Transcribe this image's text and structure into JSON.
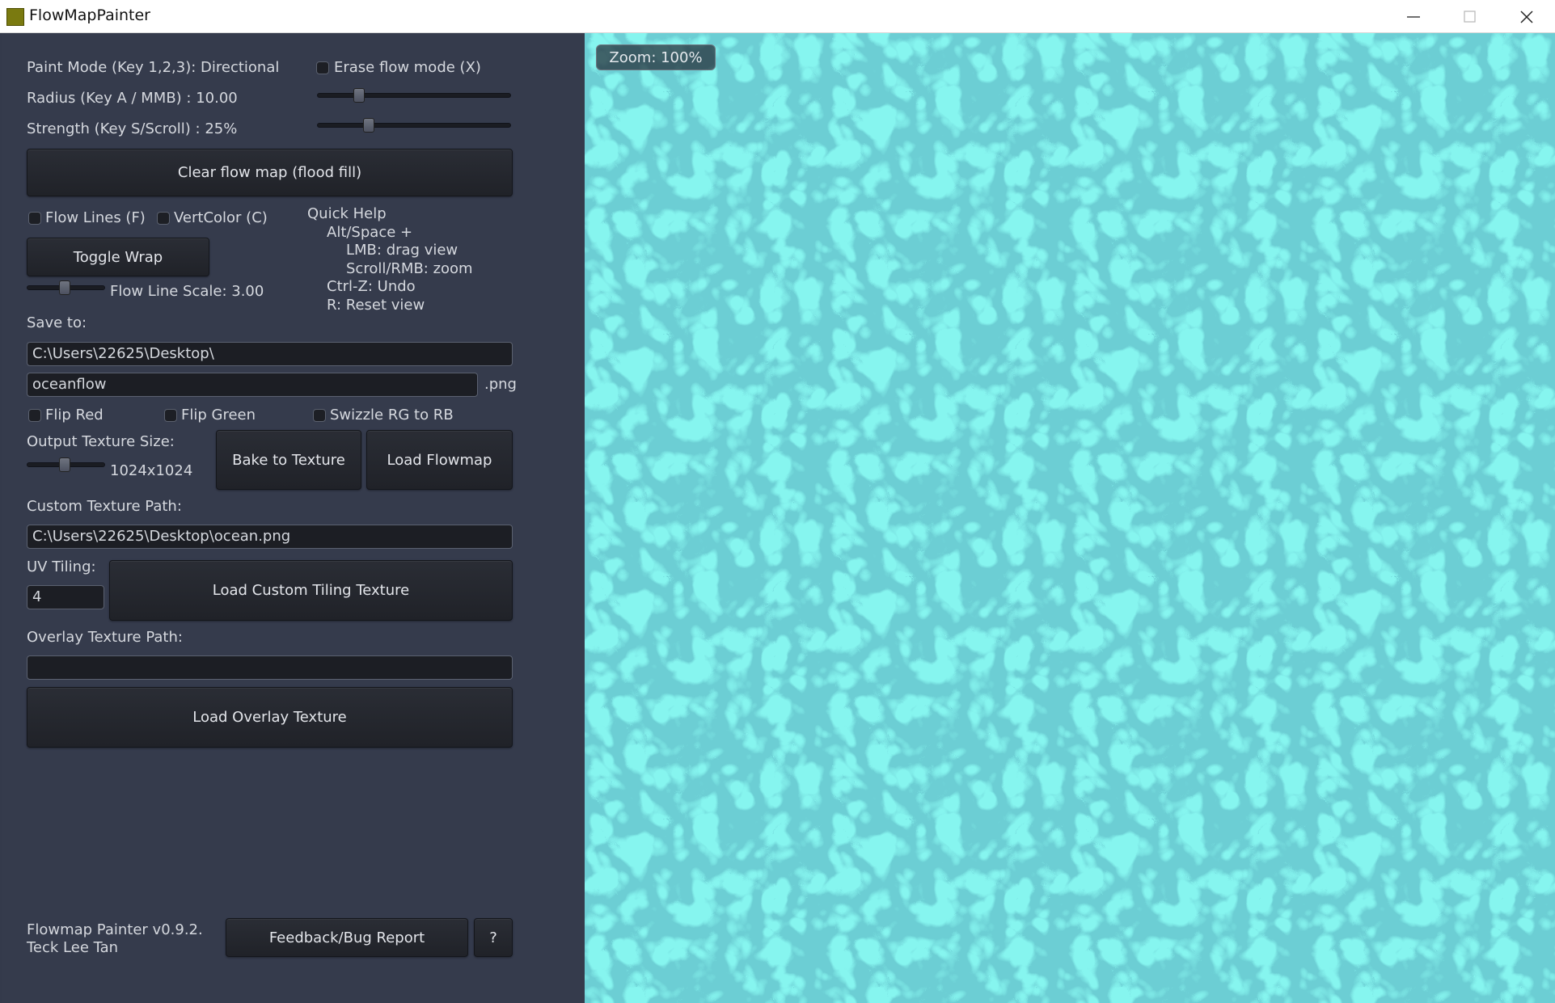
{
  "window": {
    "title": "FlowMapPainter"
  },
  "colors": {
    "panel": "#353b4c",
    "water_light": "#7ff2ea",
    "water_dark": "#0f6f7a"
  },
  "panel": {
    "paint_mode": "Paint Mode (Key 1,2,3): Directional",
    "erase_label": "Erase flow mode (X)",
    "radius": "Radius (Key A / MMB) : 10.00",
    "radius_level": 0.2,
    "strength": "Strength (Key S/Scroll) : 25%",
    "strength_level": 0.25,
    "clear_button": "Clear flow map (flood fill)",
    "flow_lines": "Flow Lines (F)",
    "vert_color": "VertColor (C)",
    "toggle_wrap": "Toggle Wrap",
    "flow_line_scale": "Flow Line Scale: 3.00",
    "help": {
      "title": "Quick Help",
      "line1": "Alt/Space +",
      "line2": "LMB: drag view",
      "line3": "Scroll/RMB: zoom",
      "line4": "Ctrl-Z: Undo",
      "line5": "R: Reset view"
    },
    "save_to": "Save to:",
    "save_path": "C:\\Users\\22625\\Desktop\\",
    "file_name": "oceanflow",
    "ext": ".png",
    "flip_red": "Flip Red",
    "flip_green": "Flip Green",
    "swizzle": "Swizzle RG to RB",
    "output_size_label": "Output Texture Size:",
    "output_size": "1024x1024",
    "bake": "Bake to Texture",
    "load_flowmap": "Load Flowmap",
    "custom_path_label": "Custom Texture Path:",
    "custom_path": "C:\\Users\\22625\\Desktop\\ocean.png",
    "uv_tiling_label": "UV Tiling:",
    "uv_tiling": "4",
    "load_custom": "Load Custom Tiling Texture",
    "overlay_label": "Overlay Texture Path:",
    "overlay_path": "",
    "load_overlay": "Load Overlay Texture",
    "version": "Flowmap Painter v0.9.2.",
    "author": "Teck Lee Tan",
    "feedback": "Feedback/Bug Report",
    "help_button": "?"
  },
  "viewport": {
    "zoom": "Zoom: 100%"
  }
}
